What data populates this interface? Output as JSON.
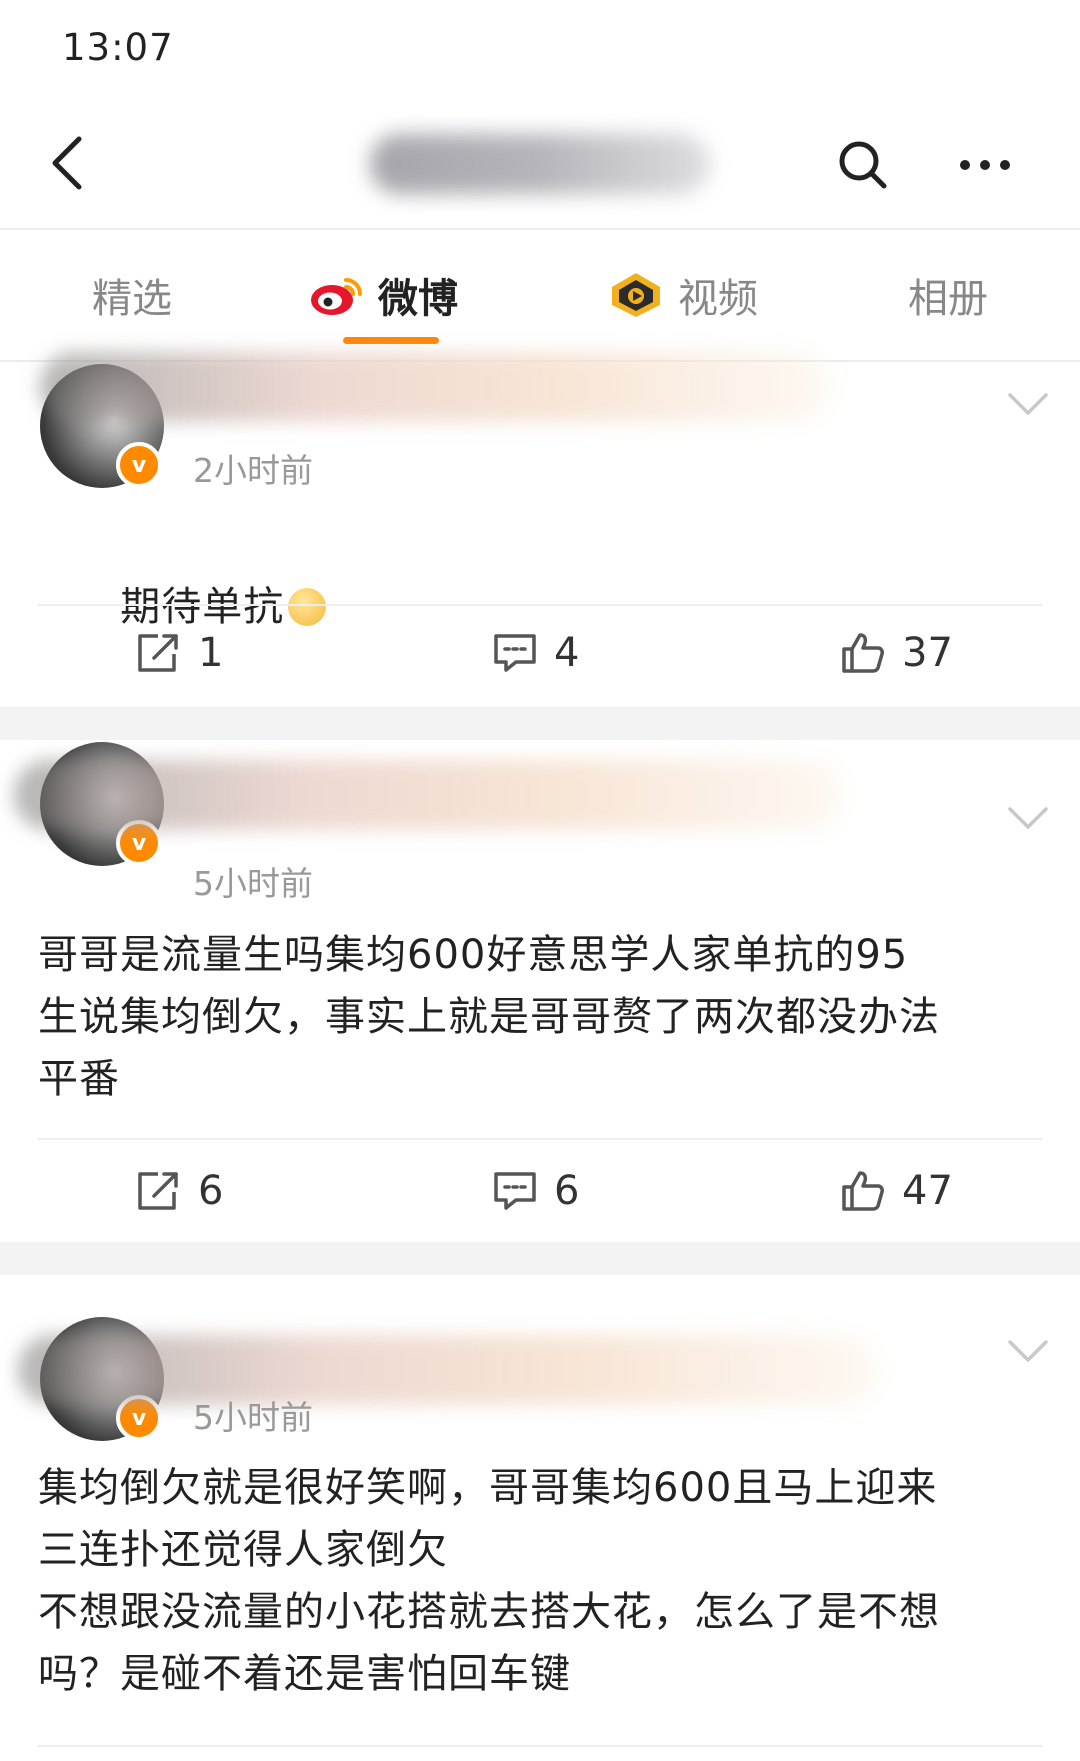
{
  "status_bar": {
    "time": "13:07"
  },
  "tabs": [
    {
      "label": "精选",
      "active": false
    },
    {
      "label": "微博",
      "active": true
    },
    {
      "label": "视频",
      "active": false
    },
    {
      "label": "相册",
      "active": false
    }
  ],
  "colors": {
    "accent": "#ff8200",
    "verified": "#ff8a00"
  },
  "posts": [
    {
      "time": "2小时前",
      "text": "期待单抗",
      "emoji": "praying-face-emoji",
      "reposts": "1",
      "comments": "4",
      "likes": "37"
    },
    {
      "time": "5小时前",
      "text": "哥哥是流量生吗集均600好意思学人家单抗的95\n生说集均倒欠，事实上就是哥哥赘了两次都没办法\n平番",
      "reposts": "6",
      "comments": "6",
      "likes": "47"
    },
    {
      "time": "5小时前",
      "text": "集均倒欠就是很好笑啊，哥哥集均600且马上迎来\n三连扑还觉得人家倒欠\n不想跟没流量的小花搭就去搭大花，怎么了是不想\n吗？是碰不着还是害怕回车键"
    }
  ]
}
